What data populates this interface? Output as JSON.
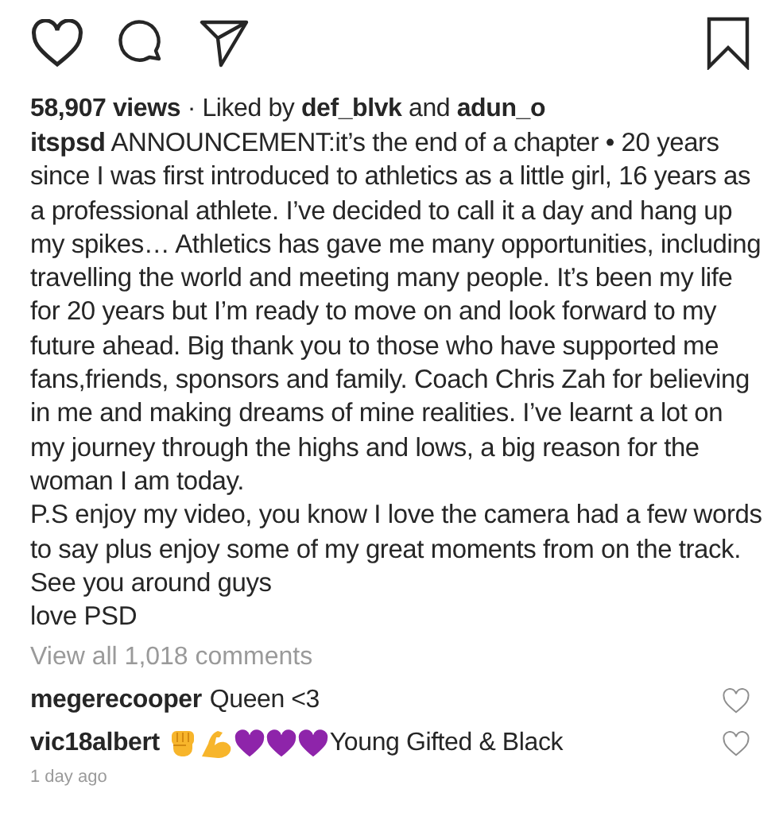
{
  "actions": {
    "liked": false,
    "saved": false
  },
  "likes": "**58,907 views** · Liked by **def_blvk** and **adun_o**",
  "caption": [
    "**itspsd** ANNOUNCEMENT:it’s the end of a chapter • 20 years since I was first introduced to athletics as a little girl, 16 years as a professional athlete. I’ve decided to call it a day and hang up my spikes… Athletics has gave me many opportunities, including travelling the world and meeting many people. It’s been my life for 20 years but I’m ready to move on and look forward to my future ahead. Big thank you to those who have supported me fans,friends, sponsors and family. Coach Chris Zah for believing in me and making dreams of mine realities. I’ve learnt a lot on my journey through the highs and lows, a big reason for the woman I am today.",
    "P.S enjoy my video, you know I love the camera had a few words to say plus enjoy some of my great moments from on the track.",
    "See you around guys",
    "love PSD"
  ],
  "view_all": "View all 1,018 comments",
  "comments": [
    {
      "user": "megerecooper",
      "text": "Queen <3",
      "liked": false
    },
    {
      "user": "vic18albert",
      "text": "Young Gifted & Black",
      "emoji": [
        {
          "kind": "fist"
        },
        {
          "kind": "flexed-arm"
        },
        {
          "kind": "purple-heart"
        },
        {
          "kind": "purple-heart"
        },
        {
          "kind": "purple-heart"
        }
      ],
      "liked": false
    }
  ],
  "time": "1 day ago"
}
